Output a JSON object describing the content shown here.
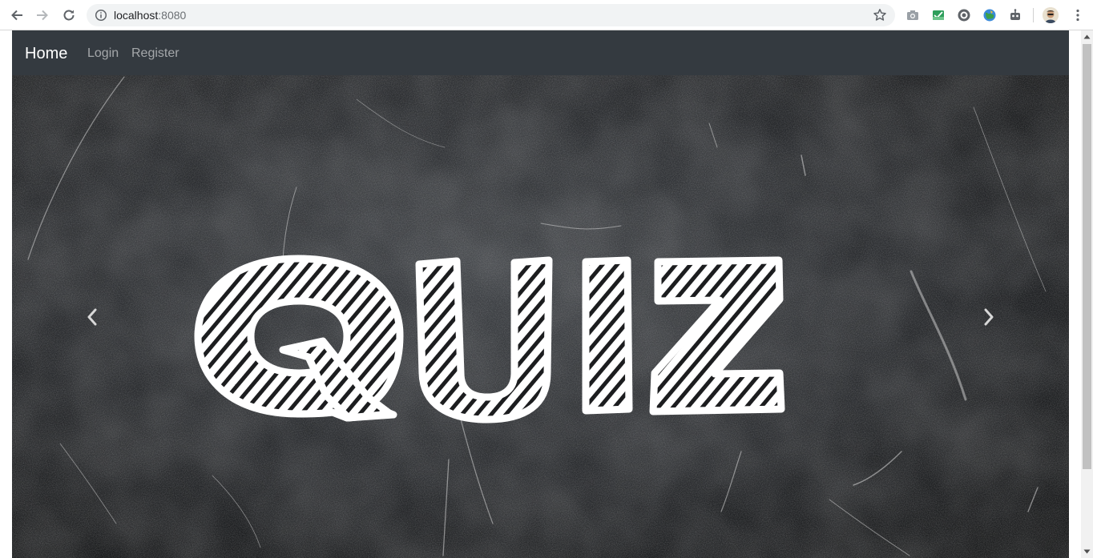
{
  "browser": {
    "url_host": "localhost",
    "url_port": ":8080",
    "icons": [
      "back-icon",
      "forward-icon",
      "reload-icon",
      "info-icon",
      "star-icon",
      "camera-icon",
      "inbox-icon",
      "extension-icon",
      "globe-icon",
      "robot-icon",
      "avatar",
      "menu-icon"
    ]
  },
  "navbar": {
    "brand": "Home",
    "links": [
      "Login",
      "Register"
    ],
    "background": "#343a40"
  },
  "carousel": {
    "slide_text": "QUIZ",
    "controls": [
      "previous",
      "next"
    ],
    "background": "#1d1e20"
  }
}
